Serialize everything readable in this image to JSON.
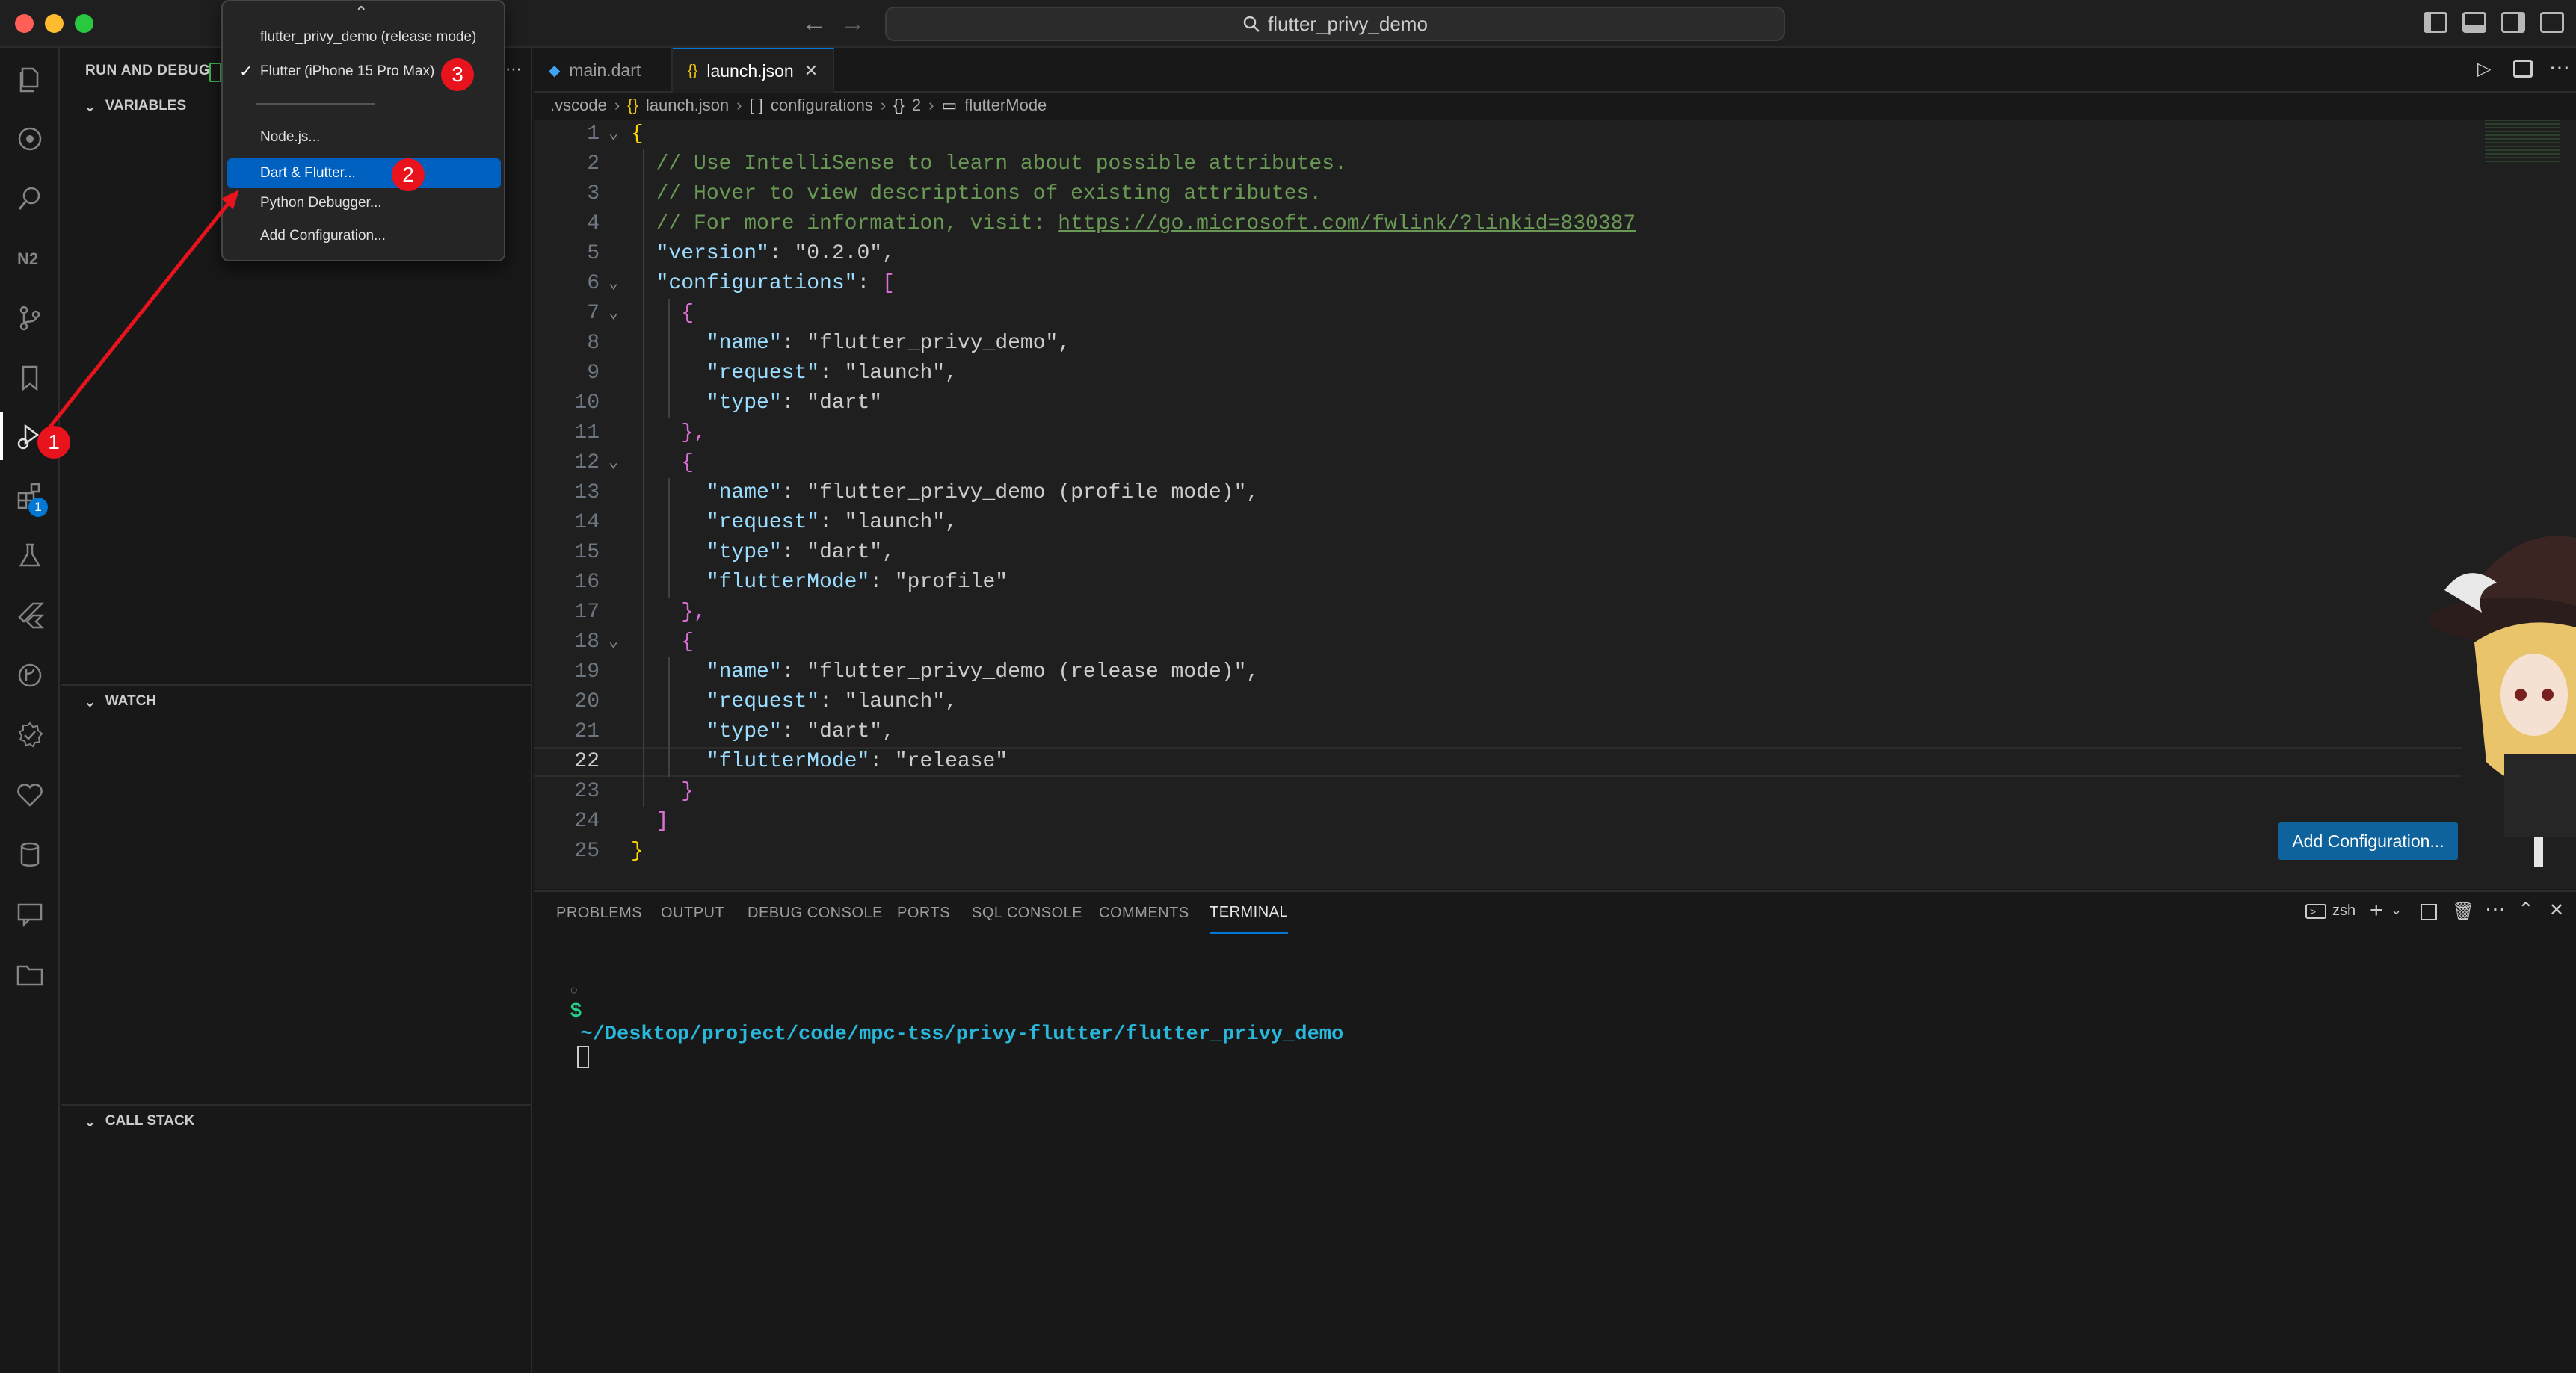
{
  "window": {
    "title": "flutter_privy_demo"
  },
  "sidebar": {
    "header": "RUN AND DEBUG",
    "sections": {
      "variables": "VARIABLES",
      "watch": "WATCH",
      "call_stack": "CALL STACK"
    }
  },
  "activitybar": {
    "extensions_badge": "1"
  },
  "tabs": [
    {
      "label": "main.dart",
      "icon": "dart-icon"
    },
    {
      "label": "launch.json",
      "icon": "json-icon"
    }
  ],
  "breadcrumb": [
    ".vscode",
    "launch.json",
    "configurations",
    "2",
    "flutterMode"
  ],
  "editor": {
    "lines": [
      [
        "1",
        "{"
      ],
      [
        "2",
        "  // Use IntelliSense to learn about possible attributes."
      ],
      [
        "3",
        "  // Hover to view descriptions of existing attributes."
      ],
      [
        "4",
        "  // For more information, visit: https://go.microsoft.com/fwlink/?linkid=830387"
      ],
      [
        "5",
        "  \"version\": \"0.2.0\","
      ],
      [
        "6",
        "  \"configurations\": ["
      ],
      [
        "7",
        "    {"
      ],
      [
        "8",
        "      \"name\": \"flutter_privy_demo\","
      ],
      [
        "9",
        "      \"request\": \"launch\","
      ],
      [
        "10",
        "      \"type\": \"dart\""
      ],
      [
        "11",
        "    },"
      ],
      [
        "12",
        "    {"
      ],
      [
        "13",
        "      \"name\": \"flutter_privy_demo (profile mode)\","
      ],
      [
        "14",
        "      \"request\": \"launch\","
      ],
      [
        "15",
        "      \"type\": \"dart\","
      ],
      [
        "16",
        "      \"flutterMode\": \"profile\""
      ],
      [
        "17",
        "    },"
      ],
      [
        "18",
        "    {"
      ],
      [
        "19",
        "      \"name\": \"flutter_privy_demo (release mode)\","
      ],
      [
        "20",
        "      \"request\": \"launch\","
      ],
      [
        "21",
        "      \"type\": \"dart\","
      ],
      [
        "22",
        "      \"flutterMode\": \"release\""
      ],
      [
        "23",
        "    }"
      ],
      [
        "24",
        "  ]"
      ],
      [
        "25",
        "}"
      ]
    ],
    "current_line": "22",
    "add_config_button": "Add Configuration..."
  },
  "panel": {
    "tabs": [
      "PROBLEMS",
      "OUTPUT",
      "DEBUG CONSOLE",
      "PORTS",
      "SQL CONSOLE",
      "COMMENTS",
      "TERMINAL"
    ],
    "active_tab": "TERMINAL",
    "shell": "zsh",
    "prompt_symbol": "$",
    "cwd": "~/Desktop/project/code/mpc-tss/privy-flutter/flutter_privy_demo"
  },
  "dropdown": {
    "items": [
      "flutter_privy_demo (release mode)",
      "Flutter (iPhone 15 Pro Max)",
      "Node.js...",
      "Dart & Flutter...",
      "Python Debugger...",
      "Add Configuration..."
    ],
    "checked": "Flutter (iPhone 15 Pro Max)",
    "highlighted": "Dart & Flutter..."
  },
  "annotations": [
    "1",
    "2",
    "3"
  ],
  "colors": {
    "accent": "#0078d4",
    "marker": "#e8131c",
    "arrow": "#e8131c"
  }
}
